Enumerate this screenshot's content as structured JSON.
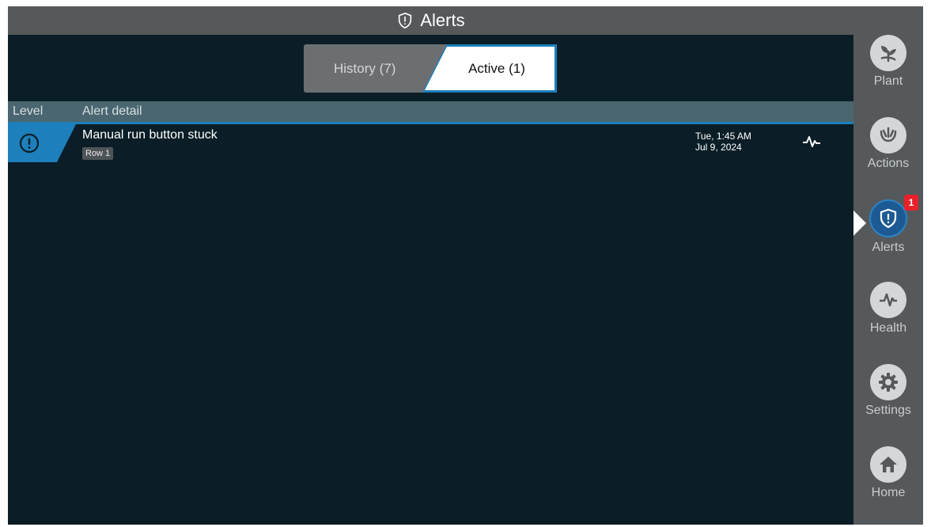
{
  "header": {
    "title": "Alerts",
    "icon": "shield-icon"
  },
  "tabs": [
    {
      "label": "History (7)",
      "selected": false
    },
    {
      "label": "Active (1)",
      "selected": true
    }
  ],
  "table": {
    "columns": [
      "Level",
      "Alert detail"
    ],
    "rows": [
      {
        "level_icon": "exclamation-circle-icon",
        "title": "Manual run button stuck",
        "tag": "Row 1",
        "time": "Tue, 1:45 AM",
        "date": "Jul 9, 2024",
        "action_icon": "health-pulse-icon"
      }
    ]
  },
  "sidebar": {
    "items": [
      {
        "label": "Plant",
        "icon": "plant-icon"
      },
      {
        "label": "Actions",
        "icon": "actions-icon"
      },
      {
        "label": "Alerts",
        "icon": "shield-alert-icon",
        "badge": "1",
        "active": true
      },
      {
        "label": "Health",
        "icon": "health-pulse-icon"
      },
      {
        "label": "Settings",
        "icon": "gear-icon"
      },
      {
        "label": "Home",
        "icon": "home-icon"
      }
    ]
  },
  "colors": {
    "accent": "#1d7fbb",
    "background": "#0b1e27",
    "sidebar": "#55595c",
    "badge": "#e8212b"
  }
}
